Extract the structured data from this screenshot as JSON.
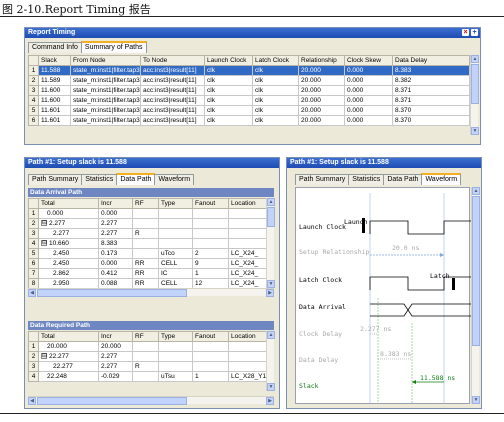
{
  "caption": "图 2-10.Report Timing 报告",
  "report_window": {
    "title": "Report Timing",
    "tabs": [
      "Command Info",
      "Summary of Paths"
    ],
    "active_tab": 1,
    "columns": [
      "",
      "Slack",
      "From Node",
      "To Node",
      "Launch Clock",
      "Latch Clock",
      "Relationship",
      "Clock Skew",
      "Data Delay"
    ],
    "rows": [
      [
        "1",
        "11.588",
        "state_m:inst1|filter.tap3",
        "acc:inst3|result[11]",
        "clk",
        "clk",
        "20.000",
        "0.000",
        "8.383"
      ],
      [
        "2",
        "11.589",
        "state_m:inst1|filter.tap3",
        "acc:inst3|result[11]",
        "clk",
        "clk",
        "20.000",
        "0.000",
        "8.382"
      ],
      [
        "3",
        "11.600",
        "state_m:inst1|filter.tap3",
        "acc:inst3|result[11]",
        "clk",
        "clk",
        "20.000",
        "0.000",
        "8.371"
      ],
      [
        "4",
        "11.600",
        "state_m:inst1|filter.tap3",
        "acc:inst3|result[11]",
        "clk",
        "clk",
        "20.000",
        "0.000",
        "8.371"
      ],
      [
        "5",
        "11.601",
        "state_m:inst1|filter.tap3",
        "acc:inst3|result[11]",
        "clk",
        "clk",
        "20.000",
        "0.000",
        "8.370"
      ],
      [
        "6",
        "11.601",
        "state_m:inst1|filter.tap3",
        "acc:inst3|result[11]",
        "clk",
        "clk",
        "20.000",
        "0.000",
        "8.370"
      ]
    ],
    "selected_row": 0
  },
  "path_left": {
    "title": "Path #1: Setup slack is 11.588",
    "tabs": [
      "Path Summary",
      "Statistics",
      "Data Path",
      "Waveform"
    ],
    "active_tab": 2,
    "arrival": {
      "label": "Data Arrival Path",
      "columns": [
        "",
        "Total",
        "Incr",
        "RF",
        "Type",
        "Fanout",
        "Location"
      ],
      "rows": [
        {
          "n": "1",
          "total": "0.000",
          "incr": "0.000",
          "rf": "",
          "type": "",
          "fanout": "",
          "loc": "",
          "tree": "",
          "indent": 1
        },
        {
          "n": "2",
          "total": "2.277",
          "incr": "2.277",
          "rf": "",
          "type": "",
          "fanout": "",
          "loc": "",
          "tree": "⊟",
          "indent": 0
        },
        {
          "n": "3",
          "total": "2.277",
          "incr": "2.277",
          "rf": "R",
          "type": "",
          "fanout": "",
          "loc": "",
          "tree": "",
          "indent": 2
        },
        {
          "n": "4",
          "total": "10.660",
          "incr": "8.383",
          "rf": "",
          "type": "",
          "fanout": "",
          "loc": "",
          "tree": "⊟",
          "indent": 0
        },
        {
          "n": "5",
          "total": "2.450",
          "incr": "0.173",
          "rf": "",
          "type": "uTco",
          "fanout": "2",
          "loc": "LC_X24_",
          "tree": "",
          "indent": 2
        },
        {
          "n": "6",
          "total": "2.450",
          "incr": "0.000",
          "rf": "RR",
          "type": "CELL",
          "fanout": "9",
          "loc": "LC_X24_",
          "tree": "",
          "indent": 2
        },
        {
          "n": "7",
          "total": "2.862",
          "incr": "0.412",
          "rf": "RR",
          "type": "IC",
          "fanout": "1",
          "loc": "LC_X24_",
          "tree": "",
          "indent": 2
        },
        {
          "n": "8",
          "total": "2.950",
          "incr": "0.088",
          "rf": "RR",
          "type": "CELL",
          "fanout": "12",
          "loc": "LC_X24_",
          "tree": "",
          "indent": 2
        }
      ]
    },
    "required": {
      "label": "Data Required Path",
      "columns": [
        "",
        "Total",
        "Incr",
        "RF",
        "Type",
        "Fanout",
        "Location"
      ],
      "rows": [
        {
          "n": "1",
          "total": "20.000",
          "incr": "20.000",
          "rf": "",
          "type": "",
          "fanout": "",
          "loc": "",
          "tree": "",
          "indent": 1
        },
        {
          "n": "2",
          "total": "22.277",
          "incr": "2.277",
          "rf": "",
          "type": "",
          "fanout": "",
          "loc": "",
          "tree": "⊟",
          "indent": 0
        },
        {
          "n": "3",
          "total": "22.277",
          "incr": "2.277",
          "rf": "R",
          "type": "",
          "fanout": "",
          "loc": "",
          "tree": "",
          "indent": 2
        },
        {
          "n": "4",
          "total": "22.248",
          "incr": "-0.029",
          "rf": "",
          "type": "uTsu",
          "fanout": "1",
          "loc": "LC_X28_Y1!",
          "tree": "",
          "indent": 1
        }
      ]
    }
  },
  "path_right": {
    "title": "Path #1: Setup slack is 11.588",
    "tabs": [
      "Path Summary",
      "Statistics",
      "Data Path",
      "Waveform"
    ],
    "active_tab": 3,
    "wave_labels": {
      "launch_clock": "Launch Clock",
      "launch_tag": "Launch",
      "setup_relationship": "Setup Relationship",
      "setup_value": "20.0 ns",
      "latch_clock": "Latch Clock",
      "latch_tag": "Latch",
      "data_arrival": "Data Arrival",
      "clock_delay": "Clock Delay",
      "clock_delay_value": "2.277 ns",
      "data_delay": "Data Delay",
      "data_delay_value": "8.383 ns",
      "slack": "Slack",
      "slack_value": "11.588 ns"
    }
  },
  "colors": {
    "titlebar": "#1d4cb4",
    "selection": "#316ac5",
    "section_header": "#6e86c2",
    "slack_green": "#127c12",
    "active_tab_accent": "#f4b020"
  }
}
